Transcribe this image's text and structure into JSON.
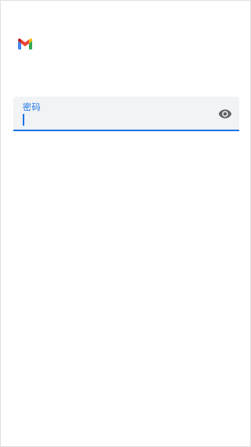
{
  "app": {
    "logo_icon": "gmail-logo-icon",
    "colors": {
      "accent": "#1a73e8",
      "field_background": "#f1f3f4",
      "icon_gray": "#5f6368"
    }
  },
  "password_field": {
    "label": "密码",
    "value": "",
    "toggle_icon": "eye-icon"
  }
}
